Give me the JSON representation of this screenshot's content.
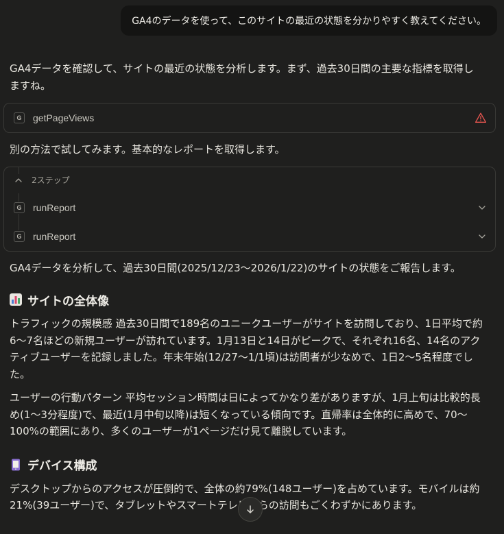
{
  "user_message": "GA4のデータを使って、このサイトの最近の状態を分かりやすく教えてください。",
  "intro": "GA4データを確認して、サイトの最近の状態を分析します。まず、過去30日間の主要な指標を取得しますね。",
  "tool_call_1": {
    "icon_letter": "G",
    "name": "getPageViews",
    "status_icon": "warning-icon"
  },
  "retry_text": "別の方法で試してみます。基本的なレポートを取得します。",
  "steps": {
    "label": "2ステップ",
    "items": [
      {
        "icon_letter": "G",
        "name": "runReport"
      },
      {
        "icon_letter": "G",
        "name": "runReport"
      }
    ]
  },
  "summary_intro": "GA4データを分析して、過去30日間(2025/12/23〜2026/1/22)のサイトの状態をご報告します。",
  "section_overview": {
    "emoji": "bar-chart-emoji",
    "title": "サイトの全体像",
    "p1": "トラフィックの規模感 過去30日間で189名のユニークユーザーがサイトを訪問しており、1日平均で約6〜7名ほどの新規ユーザーが訪れています。1月13日と14日がピークで、それぞれ16名、14名のアクティブユーザーを記録しました。年末年始(12/27〜1/1頃)は訪問者が少なめで、1日2〜5名程度でした。",
    "p2": "ユーザーの行動パターン 平均セッション時間は日によってかなり差がありますが、1月上旬は比較的長め(1〜3分程度)で、最近(1月中旬以降)は短くなっている傾向です。直帰率は全体的に高めで、70〜100%の範囲にあり、多くのユーザーが1ページだけ見て離脱しています。"
  },
  "section_device": {
    "emoji": "mobile-phone-emoji",
    "title": "デバイス構成",
    "p1": "デスクトップからのアクセスが圧倒的で、全体の約79%(148ユーザー)を占めています。モバイルは約21%(39ユーザー)で、タブレットやスマートテレビからの訪問もごくわずかにあります。"
  },
  "colors": {
    "background": "#1f1f1e",
    "user_bubble": "#141413",
    "warning": "#e5554f"
  }
}
